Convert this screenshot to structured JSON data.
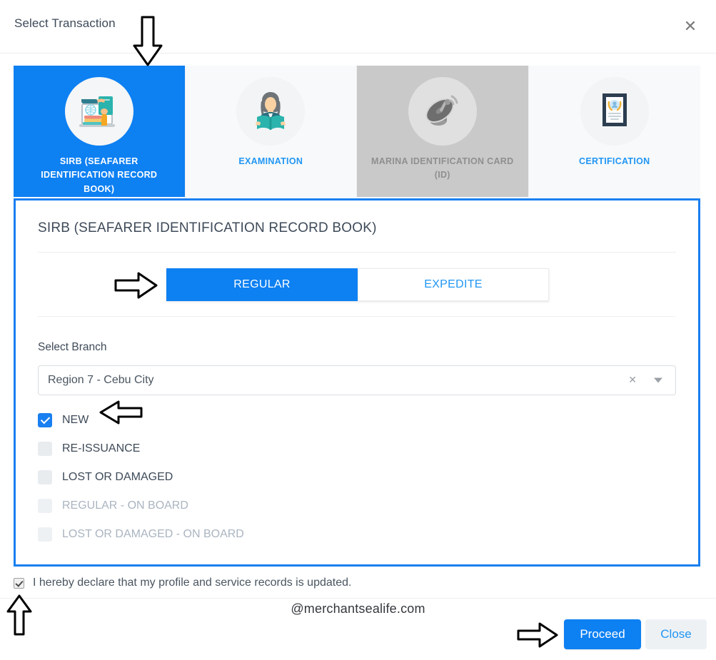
{
  "header": {
    "title": "Select Transaction",
    "close_icon": "close-icon"
  },
  "tabs": [
    {
      "label": "SIRB (SEAFARER IDENTIFICATION RECORD BOOK)",
      "icon": "laptop-books-icon",
      "state": "active"
    },
    {
      "label": "EXAMINATION",
      "icon": "person-reading-book-icon",
      "state": "enabled"
    },
    {
      "label": "MARINA IDENTIFICATION CARD (ID)",
      "icon": "satellite-dish-icon",
      "state": "disabled"
    },
    {
      "label": "CERTIFICATION",
      "icon": "certificate-icon",
      "state": "enabled"
    }
  ],
  "panel": {
    "title": "SIRB (SEAFARER IDENTIFICATION RECORD BOOK)",
    "segmented": {
      "regular_label": "REGULAR",
      "expedite_label": "EXPEDITE",
      "selected": "REGULAR"
    },
    "branch": {
      "label": "Select Branch",
      "value": "Region 7 - Cebu City",
      "placeholder": "Select Branch",
      "clear_icon": "clear-icon",
      "caret_icon": "chevron-down-icon"
    },
    "transaction_types": [
      {
        "label": "NEW",
        "checked": true,
        "disabled": false
      },
      {
        "label": "RE-ISSUANCE",
        "checked": false,
        "disabled": false
      },
      {
        "label": "LOST OR DAMAGED",
        "checked": false,
        "disabled": false
      },
      {
        "label": "REGULAR - ON BOARD",
        "checked": false,
        "disabled": true
      },
      {
        "label": "LOST OR DAMAGED - ON BOARD",
        "checked": false,
        "disabled": true
      }
    ]
  },
  "declaration": {
    "text": "I hereby declare that my profile and service records is updated.",
    "checked": true
  },
  "watermark": "@merchantsealife.com",
  "footer": {
    "proceed_label": "Proceed",
    "close_label": "Close"
  },
  "colors": {
    "accent": "#0d80f2",
    "link": "#2196f3",
    "panel_border": "#1a7ff0",
    "disabled_tab": "#c9c9c9",
    "text": "#3e4a59"
  }
}
